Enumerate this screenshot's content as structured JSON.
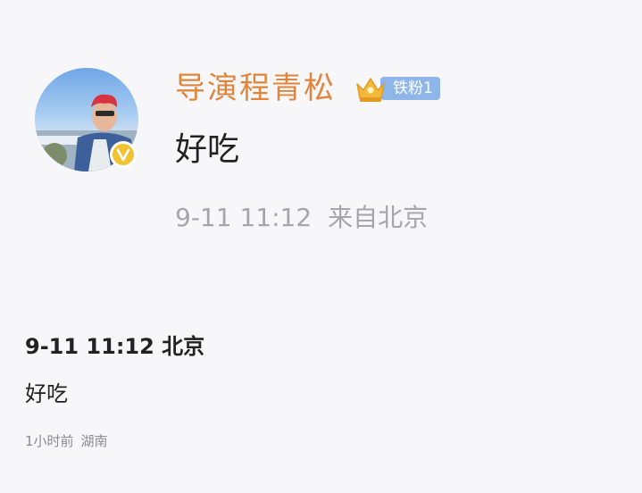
{
  "post": {
    "author": "导演程青松",
    "fan_badge": "铁粉1",
    "text": "好吃",
    "time": "9-11 11:12",
    "source": "来自北京",
    "avatar_icon": "user-photo-avatar",
    "verified_icon": "verified-v-icon",
    "crown_icon": "crown-icon"
  },
  "record": {
    "time": "9-11 11:12",
    "location": "北京",
    "text": "好吃",
    "relative_time": "1小时前",
    "ip_location": "湖南"
  },
  "colors": {
    "background": "#f7f7fa",
    "author_name": "#e0863c",
    "fan_badge": "#8fb6e8",
    "verified": "#f1c232",
    "meta_text": "#a5a5aa",
    "body_text": "#222222"
  }
}
